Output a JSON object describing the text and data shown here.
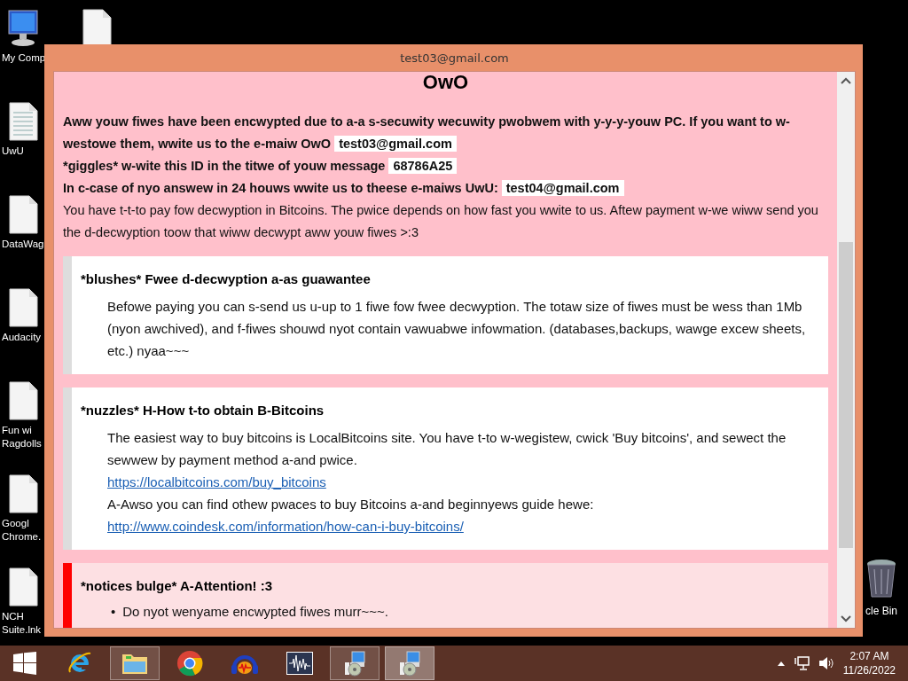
{
  "desktop_icons": [
    {
      "kind": "computer",
      "label": "My Comp"
    },
    {
      "kind": "textfile",
      "label": "UwU"
    },
    {
      "kind": "file",
      "label": "DataWag"
    },
    {
      "kind": "file",
      "label": "Audacity"
    },
    {
      "kind": "file",
      "label": "Fun wi Ragdolls"
    },
    {
      "kind": "file",
      "label": "Googl Chrome."
    },
    {
      "kind": "file",
      "label": "NCH Suite.lnk"
    }
  ],
  "desktop_icons_right": [
    {
      "kind": "file"
    },
    {
      "kind": "recycle",
      "label": "cle Bin"
    }
  ],
  "window": {
    "title": "test03@gmail.com",
    "heading": "OwO",
    "intro": [
      {
        "kind": "bold",
        "text": "Aww youw fiwes have been encwypted due to a-a s-secuwity wecuwity pwobwem with y-y-y-youw PC. If you want to w-westowe them, wwite us to the e-maiw OwO",
        "chip": "test03@gmail.com"
      },
      {
        "kind": "bold",
        "text": "*giggles* w-wite this ID in the titwe of youw message",
        "chip": "68786A25"
      },
      {
        "kind": "bold",
        "text": "In c-case of nyo answew in 24 houws wwite us to theese e-maiws UwU:",
        "chip": "test04@gmail.com"
      },
      {
        "kind": "plain",
        "text": "You have t-t-to pay fow decwyption in Bitcoins. The pwice depends on how fast you wwite to us. Aftew payment w-we wiww send you the d-decwyption toow that wiww decwypt aww youw fiwes >:3"
      }
    ],
    "sections": [
      {
        "kind": "info",
        "title": "*blushes* Fwee d-decwyption a-as guawantee",
        "items": [
          {
            "kind": "text",
            "text": "Befowe paying you can s-send us u-up to 1 fiwe fow fwee decwyption. The totaw size of fiwes must be wess than 1Mb (nyon awchived), and f-fiwes shouwd nyot contain vawuabwe infowmation. (databases,backups, wawge excew sheets, etc.) nyaa~~~"
          }
        ]
      },
      {
        "kind": "info",
        "title": "*nuzzles* H-How t-to obtain B-Bitcoins",
        "items": [
          {
            "kind": "text",
            "text": "The easiest way to buy bitcoins is LocalBitcoins site. You have t-to w-wegistew, cwick 'Buy bitcoins', and sewect the sewwew by payment method a-and pwice."
          },
          {
            "kind": "link",
            "text": "https://localbitcoins.com/buy_bitcoins"
          },
          {
            "kind": "text",
            "text": "A-Awso you can find othew pwaces to buy Bitcoins a-and beginnyews guide hewe:"
          },
          {
            "kind": "link",
            "text": "http://www.coindesk.com/information/how-can-i-buy-bitcoins/"
          }
        ]
      },
      {
        "kind": "warning",
        "title": "*notices bulge* A-Attention! :3",
        "items": [
          {
            "kind": "bullet",
            "marker": "•",
            "text": "Do nyot wenyame encwypted fiwes murr~~~."
          }
        ]
      }
    ]
  },
  "taskbar": {
    "items": [
      {
        "kind": "start",
        "open": false,
        "selected": false
      },
      {
        "kind": "ie",
        "open": false,
        "selected": false
      },
      {
        "kind": "explorer",
        "open": true,
        "selected": false
      },
      {
        "kind": "chrome",
        "open": false,
        "selected": false
      },
      {
        "kind": "audacity",
        "open": false,
        "selected": false
      },
      {
        "kind": "wave",
        "open": false,
        "selected": false
      },
      {
        "kind": "installer",
        "open": true,
        "selected": false
      },
      {
        "kind": "installer",
        "open": true,
        "selected": true
      }
    ],
    "time": "2:07 AM",
    "date": "11/26/2022"
  }
}
